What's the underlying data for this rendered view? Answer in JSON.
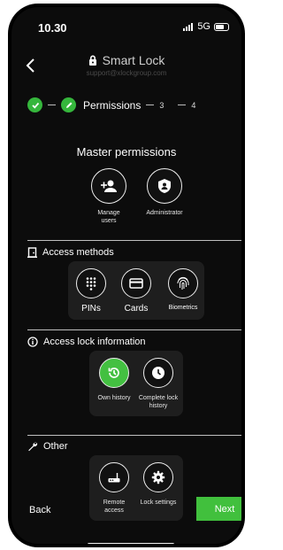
{
  "status_bar": {
    "time": "10.30",
    "network": "5G"
  },
  "header": {
    "title": "Smart Lock",
    "subtitle": "support@xlockgroup.com"
  },
  "stepper": {
    "current_label": "Permissions",
    "step3": "3",
    "step4": "4"
  },
  "master": {
    "title": "Master permissions",
    "items": [
      {
        "label": "Manage users",
        "icon": "add-user-icon"
      },
      {
        "label": "Administrator",
        "icon": "shield-icon"
      }
    ]
  },
  "access_methods": {
    "title": "Access methods",
    "items": [
      {
        "label": "PINs",
        "icon": "keypad-icon"
      },
      {
        "label": "Cards",
        "icon": "card-icon"
      },
      {
        "label": "Biometrics",
        "icon": "fingerprint-icon"
      }
    ]
  },
  "lock_info": {
    "title": "Access lock information",
    "items": [
      {
        "label": "Own history",
        "icon": "history-icon",
        "selected": true
      },
      {
        "label": "Complete lock history",
        "icon": "clock-icon",
        "selected": false
      }
    ]
  },
  "other": {
    "title": "Other",
    "items": [
      {
        "label": "Remote access",
        "icon": "router-icon"
      },
      {
        "label": "Lock settings",
        "icon": "gear-icon"
      }
    ]
  },
  "footer": {
    "back_label": "Back",
    "next_label": "Next"
  },
  "colors": {
    "accent": "#41c03d",
    "background": "#0c0c0c",
    "panel": "#1e1e1e"
  }
}
